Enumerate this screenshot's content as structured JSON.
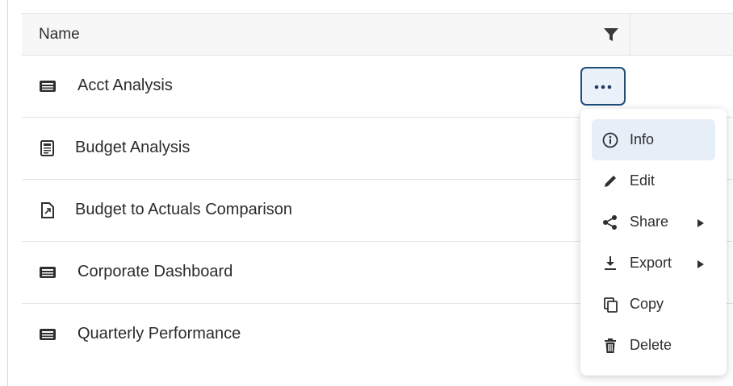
{
  "table": {
    "header": {
      "name_label": "Name"
    },
    "rows": [
      {
        "label": "Acct Analysis",
        "icon": "dashboard-icon"
      },
      {
        "label": "Budget Analysis",
        "icon": "report-icon"
      },
      {
        "label": "Budget to Actuals Comparison",
        "icon": "document-icon"
      },
      {
        "label": "Corporate Dashboard",
        "icon": "dashboard-icon"
      },
      {
        "label": "Quarterly Performance",
        "icon": "dashboard-icon"
      }
    ]
  },
  "more_button": {
    "icon": "more-horizontal-icon"
  },
  "context_menu": {
    "items": [
      {
        "label": "Info",
        "icon": "info-icon",
        "active": true
      },
      {
        "label": "Edit",
        "icon": "pencil-icon"
      },
      {
        "label": "Share",
        "icon": "share-icon",
        "has_submenu": true
      },
      {
        "label": "Export",
        "icon": "download-icon",
        "has_submenu": true
      },
      {
        "label": "Copy",
        "icon": "copy-icon"
      },
      {
        "label": "Delete",
        "icon": "trash-icon"
      }
    ]
  },
  "colors": {
    "accent": "#1f4e79",
    "active_background": "#e6eef7",
    "header_background": "#f7f7f7"
  }
}
